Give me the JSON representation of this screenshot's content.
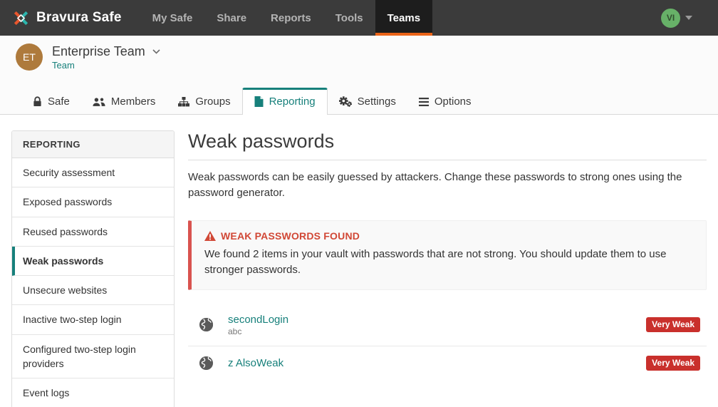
{
  "navbar": {
    "brand": "Bravura Safe",
    "items": [
      {
        "label": "My Safe",
        "active": false
      },
      {
        "label": "Share",
        "active": false
      },
      {
        "label": "Reports",
        "active": false
      },
      {
        "label": "Tools",
        "active": false
      },
      {
        "label": "Teams",
        "active": true
      }
    ],
    "avatar_initials": "VI"
  },
  "team_header": {
    "avatar_initials": "ET",
    "name": "Enterprise Team",
    "subtitle": "Team"
  },
  "tabs": [
    {
      "label": "Safe",
      "icon": "lock-icon",
      "active": false
    },
    {
      "label": "Members",
      "icon": "users-icon",
      "active": false
    },
    {
      "label": "Groups",
      "icon": "sitemap-icon",
      "active": false
    },
    {
      "label": "Reporting",
      "icon": "file-icon",
      "active": true
    },
    {
      "label": "Settings",
      "icon": "gears-icon",
      "active": false
    },
    {
      "label": "Options",
      "icon": "menu-icon",
      "active": false
    }
  ],
  "sidebar": {
    "header": "REPORTING",
    "items": [
      {
        "label": "Security assessment",
        "active": false
      },
      {
        "label": "Exposed passwords",
        "active": false
      },
      {
        "label": "Reused passwords",
        "active": false
      },
      {
        "label": "Weak passwords",
        "active": true
      },
      {
        "label": "Unsecure websites",
        "active": false
      },
      {
        "label": "Inactive two-step login",
        "active": false
      },
      {
        "label": "Configured two-step login providers",
        "active": false
      },
      {
        "label": "Event logs",
        "active": false
      }
    ]
  },
  "main": {
    "title": "Weak passwords",
    "description": "Weak passwords can be easily guessed by attackers. Change these passwords to strong ones using the password generator.",
    "callout": {
      "title": "WEAK PASSWORDS FOUND",
      "body": "We found 2 items in your vault with passwords that are not strong. You should update them to use stronger passwords."
    },
    "items": [
      {
        "name": "secondLogin",
        "username": "abc",
        "badge": "Very Weak",
        "icon": "globe-icon"
      },
      {
        "name": "z AlsoWeak",
        "username": "",
        "badge": "Very Weak",
        "icon": "globe-icon"
      }
    ]
  },
  "colors": {
    "accent_teal": "#17807b",
    "accent_orange": "#eb6418",
    "danger_border": "#d9534f",
    "danger_text": "#d14836",
    "badge_red": "#c9302c",
    "navbar_bg": "#3b3b3b",
    "avatar_team": "#ae7a3c",
    "avatar_user": "#67b168"
  }
}
